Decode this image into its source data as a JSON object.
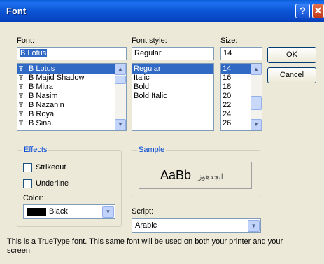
{
  "window": {
    "title": "Font",
    "help_label": "?",
    "close_label": "✕"
  },
  "font": {
    "label": "Font:",
    "value": "B Lotus",
    "items": [
      "B Lotus",
      "B Majid Shadow",
      "B Mitra",
      "B Nasim",
      "B Nazanin",
      "B Roya",
      "B Sina"
    ],
    "selected": "B Lotus",
    "item_icon": "truetype-icon",
    "item_icon_glyph": "Ŧ"
  },
  "style": {
    "label": "Font style:",
    "value": "Regular",
    "items": [
      "Regular",
      "Italic",
      "Bold",
      "Bold Italic"
    ],
    "selected": "Regular"
  },
  "size": {
    "label": "Size:",
    "value": "14",
    "items": [
      "14",
      "16",
      "18",
      "20",
      "22",
      "24",
      "26"
    ],
    "selected": "14"
  },
  "buttons": {
    "ok": "OK",
    "cancel": "Cancel"
  },
  "effects": {
    "title": "Effects",
    "strikeout": "Strikeout",
    "underline": "Underline",
    "strikeout_checked": false,
    "underline_checked": false,
    "color_label": "Color:",
    "color_value": "Black",
    "color_swatch": "#000000"
  },
  "sample": {
    "title": "Sample",
    "latin": "AaBb",
    "arabic": "ابجدهوز"
  },
  "script": {
    "label": "Script:",
    "value": "Arabic"
  },
  "info": "This is a TrueType font. This same font will be used on both your printer and your screen.",
  "colors": {
    "title_bar": "#0b55d4",
    "selection": "#316ac5",
    "group_title": "#0046d5"
  }
}
